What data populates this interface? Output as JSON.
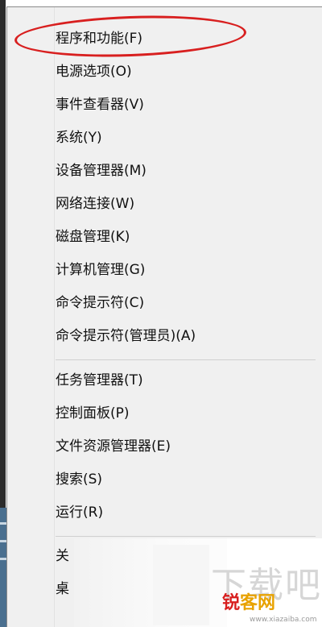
{
  "menu": {
    "group1": [
      "程序和功能(F)",
      "电源选项(O)",
      "事件查看器(V)",
      "系统(Y)",
      "设备管理器(M)",
      "网络连接(W)",
      "磁盘管理(K)",
      "计算机管理(G)",
      "命令提示符(C)",
      "命令提示符(管理员)(A)"
    ],
    "group2": [
      "任务管理器(T)",
      "控制面板(P)",
      "文件资源管理器(E)",
      "搜索(S)",
      "运行(R)"
    ],
    "group3": [
      "关",
      "桌"
    ]
  },
  "watermark": {
    "text": "下载吧",
    "logo_part1": "锐",
    "logo_part2": "客网",
    "url": "www.xiazaiba.com"
  },
  "highlight_color": "#d81f1f"
}
